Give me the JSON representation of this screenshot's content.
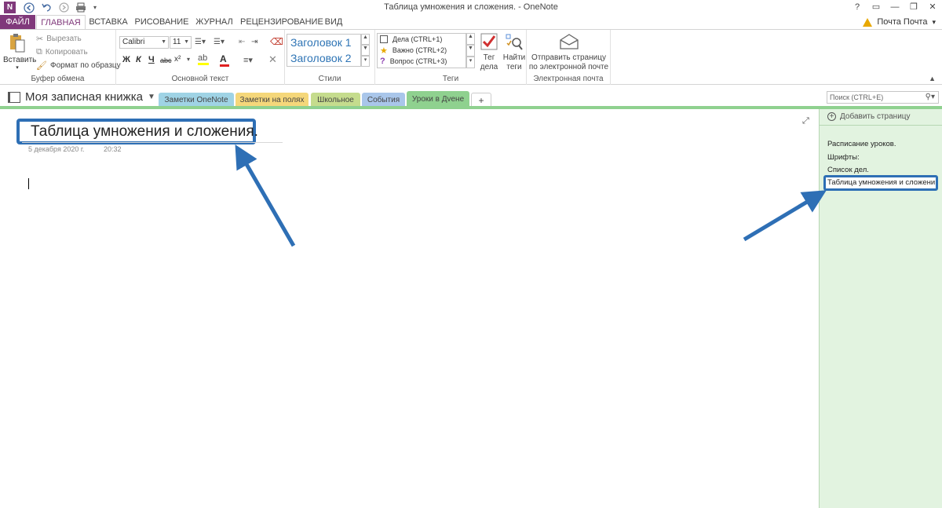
{
  "window": {
    "title": "Таблица умножения и сложения. - OneNote",
    "controls": [
      "?",
      "▭",
      "—",
      "❐",
      "✕"
    ]
  },
  "app_icon": "N",
  "ribbon_tabs": [
    "ФАЙЛ",
    "ГЛАВНАЯ",
    "ВСТАВКА",
    "РИСОВАНИЕ",
    "ЖУРНАЛ",
    "РЕЦЕНЗИРОВАНИЕ",
    "ВИД"
  ],
  "account": {
    "name": "Почта Почта",
    "arrow": "▾"
  },
  "clipboard": {
    "paste": "Вставить",
    "cut": "Вырезать",
    "copy": "Копировать",
    "format_painter": "Формат по образцу",
    "label": "Буфер обмена"
  },
  "basic_text": {
    "font": "Calibri",
    "size": "11",
    "bold": "Ж",
    "italic": "К",
    "underline": "Ч",
    "strike": "abc",
    "superscript": "x²",
    "label": "Основной текст"
  },
  "styles": {
    "heading1": "Заголовок 1",
    "heading2": "Заголовок 2",
    "label": "Стили"
  },
  "tags": {
    "items": [
      "Дела (CTRL+1)",
      "Важно (CTRL+2)",
      "Вопрос (CTRL+3)"
    ],
    "tag_todo": "Тег\nдела",
    "find_tags": "Найти\nтеги",
    "label": "Теги"
  },
  "email": {
    "send": "Отправить страницу\nпо электронной почте",
    "label": "Электронная почта"
  },
  "notebook": {
    "name": "Моя записная книжка",
    "sections": [
      "Заметки OneNote",
      "Заметки на полях",
      "Школьное",
      "События",
      "Уроки в Дvене",
      "+"
    ],
    "section_colors": [
      "#9fd3e5",
      "#f5d77a",
      "#c5dc8d",
      "#a9c6ea",
      "#8fd18f",
      "#ffffff"
    ],
    "search_placeholder": "Поиск (CTRL+E)"
  },
  "page": {
    "title": "Таблица умножения и сложения.",
    "date": "5 декабря 2020 г.",
    "time": "20:32"
  },
  "page_list": {
    "add_page": "Добавить страницу",
    "items": [
      "Расписание уроков.",
      "Шрифты:",
      "Список дел.",
      "Таблица умножения и сложени"
    ]
  },
  "annotation_color": "#2e6fb5"
}
